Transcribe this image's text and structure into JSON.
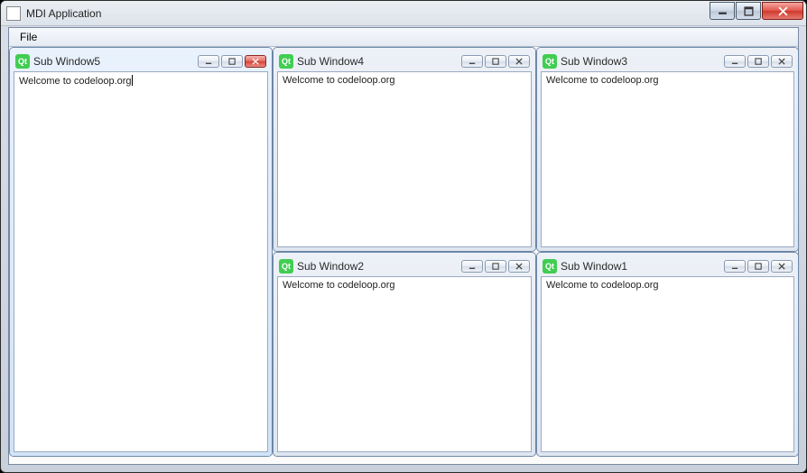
{
  "window": {
    "title": "MDI Application"
  },
  "menubar": {
    "file": "File"
  },
  "subwindows": {
    "win5": {
      "title": "Sub Window5",
      "content": "Welcome to codeloop.org",
      "active": true
    },
    "win4": {
      "title": "Sub Window4",
      "content": "Welcome to codeloop.org"
    },
    "win3": {
      "title": "Sub Window3",
      "content": "Welcome to codeloop.org"
    },
    "win2": {
      "title": "Sub Window2",
      "content": "Welcome to codeloop.org"
    },
    "win1": {
      "title": "Sub Window1",
      "content": "Welcome to codeloop.org"
    }
  }
}
